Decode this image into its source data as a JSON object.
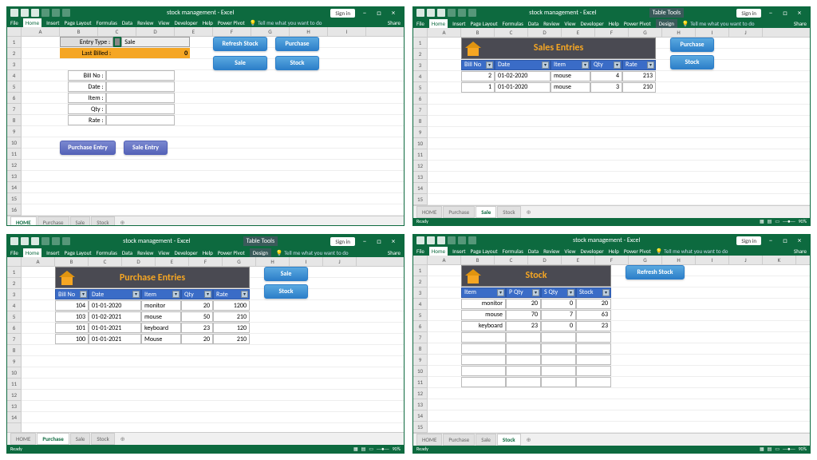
{
  "doc_title": "stock management - Excel",
  "signin": "Sign in",
  "share": "Share",
  "ribbon": [
    "File",
    "Home",
    "Insert",
    "Page Layout",
    "Formulas",
    "Data",
    "Review",
    "View",
    "Developer",
    "Help",
    "Power Pivot"
  ],
  "tell": "Tell me what you want to do",
  "design": "Design",
  "tabletools": "Table Tools",
  "ready": "Ready",
  "zoom": "90%",
  "panels": [
    {
      "tabs": [
        "HOME",
        "Purchase",
        "Sale",
        "Stock"
      ],
      "active": 0,
      "cols": [
        "A",
        "B",
        "C",
        "D",
        "E",
        "F",
        "G",
        "H",
        "I"
      ],
      "rows": 16,
      "ctx": false,
      "home": {
        "entry_type_lbl": "Entry Type :",
        "entry_type_val": "Sale",
        "last_billed_lbl": "Last Billed :",
        "last_billed_val": "0",
        "form": [
          "Bill No :",
          "Date :",
          "Item :",
          "Qty :",
          "Rate :"
        ],
        "btns": {
          "pe": "Purchase Entry",
          "se": "Sale Entry",
          "rs": "Refresh Stock",
          "pu": "Purchase",
          "sa": "Sale",
          "st": "Stock"
        }
      }
    },
    {
      "tabs": [
        "HOME",
        "Purchase",
        "Sale",
        "Stock"
      ],
      "active": 2,
      "cols": [
        "A",
        "B",
        "C",
        "D",
        "E",
        "F",
        "G",
        "H",
        "I",
        "J"
      ],
      "rows": 15,
      "ctx": true,
      "sales": {
        "title": "Sales Entries",
        "headers": [
          "Bill No",
          "Date",
          "Item",
          "Qty",
          "Rate"
        ],
        "rows": [
          [
            "2",
            "01-02-2020",
            "mouse",
            "4",
            "213"
          ],
          [
            "1",
            "01-01-2020",
            "mouse",
            "3",
            "210"
          ]
        ],
        "btns": {
          "pu": "Purchase",
          "st": "Stock"
        }
      }
    },
    {
      "tabs": [
        "HOME",
        "Purchase",
        "Sale",
        "Stock"
      ],
      "active": 1,
      "cols": [
        "A",
        "B",
        "C",
        "D",
        "E",
        "F",
        "G",
        "H",
        "I",
        "J"
      ],
      "rows": 14,
      "ctx": true,
      "purchase": {
        "title": "Purchase Entries",
        "headers": [
          "Bill No",
          "Date",
          "Item",
          "Qty",
          "Rate"
        ],
        "rows": [
          [
            "104",
            "01-01-2020",
            "monitor",
            "20",
            "1200"
          ],
          [
            "103",
            "01-02-2021",
            "mouse",
            "50",
            "210"
          ],
          [
            "101",
            "01-01-2021",
            "keyboard",
            "23",
            "120"
          ],
          [
            "100",
            "01-01-2021",
            "Mouse",
            "20",
            "210"
          ]
        ],
        "btns": {
          "sa": "Sale",
          "st": "Stock"
        }
      }
    },
    {
      "tabs": [
        "HOME",
        "Purchase",
        "Sale",
        "Stock"
      ],
      "active": 3,
      "cols": [
        "A",
        "B",
        "C",
        "D",
        "E",
        "F",
        "G",
        "H",
        "I",
        "J",
        "K"
      ],
      "rows": 15,
      "ctx": false,
      "stock": {
        "title": "Stock",
        "headers": [
          "Item",
          "P Qty",
          "S Qty",
          "Stock"
        ],
        "rows": [
          [
            "monitor",
            "20",
            "0",
            "20"
          ],
          [
            "mouse",
            "70",
            "7",
            "63"
          ],
          [
            "keyboard",
            "23",
            "0",
            "23"
          ],
          [
            "",
            "",
            "",
            ""
          ],
          [
            "",
            "",
            "",
            ""
          ],
          [
            "",
            "",
            "",
            ""
          ],
          [
            "",
            "",
            "",
            ""
          ],
          [
            "",
            "",
            "",
            ""
          ]
        ],
        "btns": {
          "rs": "Refresh Stock"
        }
      }
    }
  ]
}
